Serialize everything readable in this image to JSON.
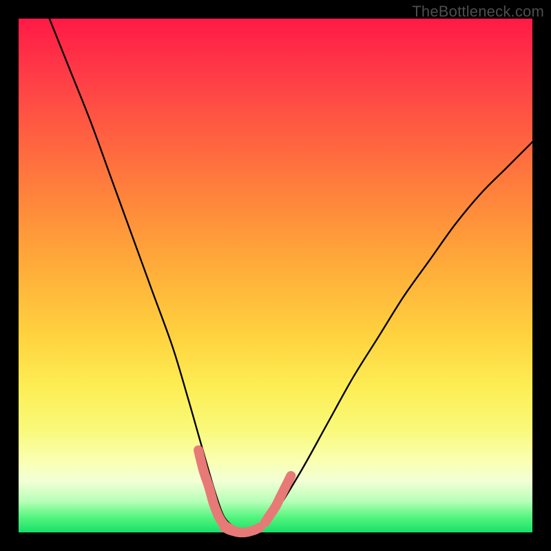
{
  "watermark": "TheBottleneck.com",
  "chart_data": {
    "type": "line",
    "title": "",
    "xlabel": "",
    "ylabel": "",
    "xlim": [
      0,
      100
    ],
    "ylim": [
      0,
      100
    ],
    "grid": false,
    "series": [
      {
        "name": "curve",
        "color": "#000000",
        "x": [
          6,
          10,
          14,
          18,
          22,
          26,
          30,
          33,
          35,
          37,
          38.5,
          40,
          42,
          44,
          46,
          47,
          50,
          55,
          60,
          65,
          70,
          75,
          80,
          85,
          90,
          95,
          100
        ],
        "y": [
          100,
          90,
          80,
          69,
          58,
          47,
          36,
          26,
          19,
          12,
          7,
          3,
          1,
          0,
          0,
          1,
          4,
          12,
          21,
          30,
          38,
          46,
          53,
          60,
          66,
          71,
          76
        ]
      },
      {
        "name": "highlight-left",
        "color": "#e77a76",
        "style": "thick",
        "x": [
          35,
          36,
          37,
          38,
          39,
          40,
          41,
          42,
          43
        ],
        "y": [
          16,
          12,
          9,
          5.5,
          3,
          1.5,
          0.8,
          0.3,
          0
        ]
      },
      {
        "name": "highlight-bottom",
        "color": "#e77a76",
        "style": "thick",
        "x": [
          40,
          41,
          42,
          43,
          44,
          45,
          46,
          47
        ],
        "y": [
          1.0,
          0.5,
          0.2,
          0,
          0,
          0.2,
          0.5,
          1.0
        ]
      },
      {
        "name": "highlight-right",
        "color": "#e77a76",
        "style": "thick",
        "x": [
          48,
          49,
          50,
          51,
          52,
          53
        ],
        "y": [
          2,
          3.5,
          5,
          7,
          9,
          11
        ]
      }
    ]
  }
}
